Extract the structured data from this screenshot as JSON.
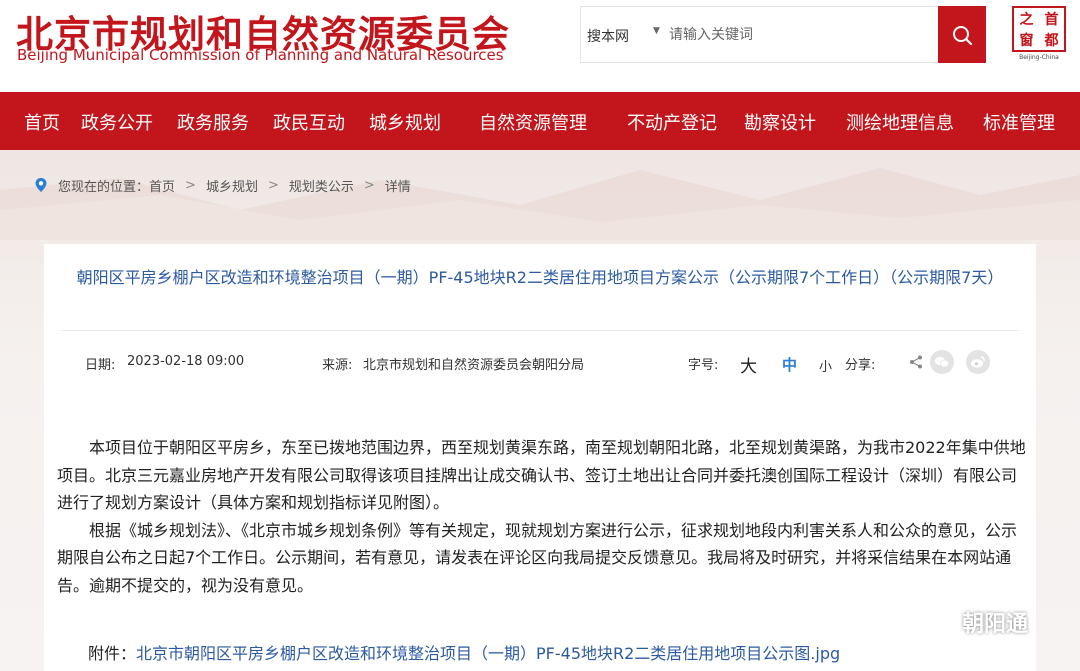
{
  "header": {
    "site_title": "北京市规划和自然资源委员会",
    "site_subtitle": "Beijing Municipal Commission of Planning and Natural Resources",
    "search": {
      "scope": "搜本网",
      "placeholder": "请输入关键词"
    },
    "logo": {
      "chars": [
        "之",
        "首",
        "窗",
        "都"
      ],
      "caption": "Beijing-China"
    }
  },
  "nav": {
    "items": [
      "首页",
      "政务公开",
      "政务服务",
      "政民互动",
      "城乡规划",
      "自然资源管理",
      "不动产登记",
      "勘察设计",
      "测绘地理信息",
      "标准管理"
    ]
  },
  "breadcrumb": {
    "prefix": "您现在的位置：",
    "items": [
      "首页",
      "城乡规划",
      "规划类公示",
      "详情"
    ],
    "separator": ">"
  },
  "article": {
    "title": "朝阳区平房乡棚户区改造和环境整治项目（一期）PF-45地块R2二类居住用地项目方案公示（公示期限7个工作日）（公示期限7天）",
    "date_label": "日期:",
    "date": "2023-02-18 09:00",
    "source_label": "来源:",
    "source": "北京市规划和自然资源委员会朝阳分局",
    "font_size_label": "字号:",
    "font_sizes": [
      "大",
      "中",
      "小"
    ],
    "share_label": "分享:",
    "paragraphs": [
      "本项目位于朝阳区平房乡，东至已拨地范围边界，西至规划黄渠东路，南至规划朝阳北路，北至规划黄渠路，为我市2022年集中供地项目。北京三元嘉业房地产开发有限公司取得该项目挂牌出让成交确认书、签订土地出让合同并委托澳创国际工程设计（深圳）有限公司进行了规划方案设计（具体方案和规划指标详见附图）。",
      "根据《城乡规划法》、《北京市城乡规划条例》等有关规定，现就规划方案进行公示，征求规划地段内利害关系人和公众的意见，公示期限自公布之日起7个工作日。公示期间，若有意见，请发表在评论区向我局提交反馈意见。我局将及时研究，并将采信结果在本网站通告。逾期不提交的，视为没有意见。"
    ],
    "attachment_label": "附件：",
    "attachment_link": "北京市朝阳区平房乡棚户区改造和环境整治项目（一期）PF-45地块R2二类居住用地项目公示图.jpg"
  },
  "watermark": "朝阳通",
  "colors": {
    "brand_red": "#c3161c",
    "link_blue": "#2c5aa0",
    "active_font": "#2c7dd8"
  },
  "icons": [
    "search-icon",
    "location-pin-icon",
    "share-icon",
    "wechat-icon",
    "weibo-icon"
  ]
}
